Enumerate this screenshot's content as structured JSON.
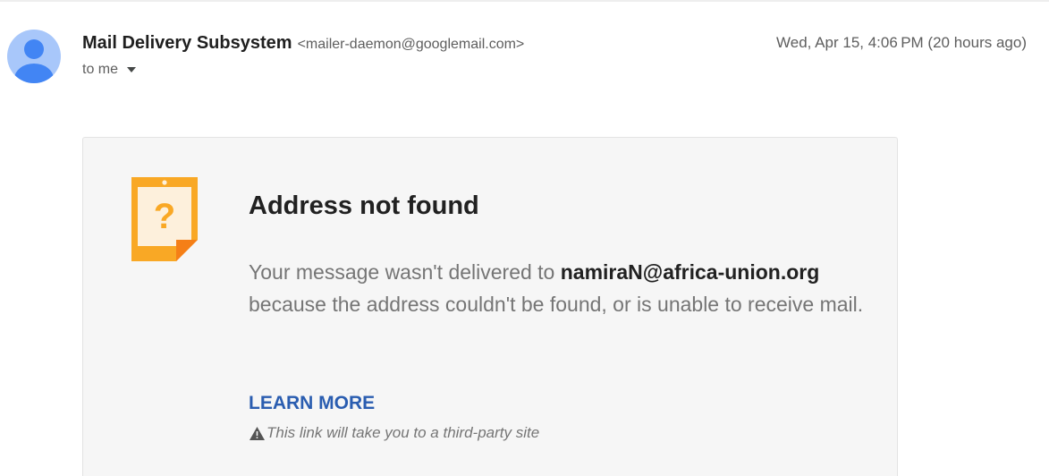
{
  "message": {
    "sender_name": "Mail Delivery Subsystem",
    "sender_email": "<mailer-daemon@googlemail.com>",
    "recipient_label": "to me",
    "timestamp": "Wed, Apr 15, 4:06 PM (20 hours ago)",
    "avatar_icon": "person-icon"
  },
  "bounce_card": {
    "icon": "question-note-icon",
    "title": "Address not found",
    "body_prefix": "Your message wasn't delivered to ",
    "bounced_address": "namiraN@africa-union.org",
    "body_suffix": " because the address couldn't be found, or is unable to receive mail.",
    "learn_more_label": "LEARN MORE",
    "warning_text": "This link will take you to a third-party site",
    "warning_icon": "warning-triangle-icon"
  },
  "colors": {
    "avatar_bg": "#a8c7fa",
    "avatar_fg": "#4285f4",
    "note_orange": "#f9a825",
    "link_blue": "#2a5db0"
  }
}
